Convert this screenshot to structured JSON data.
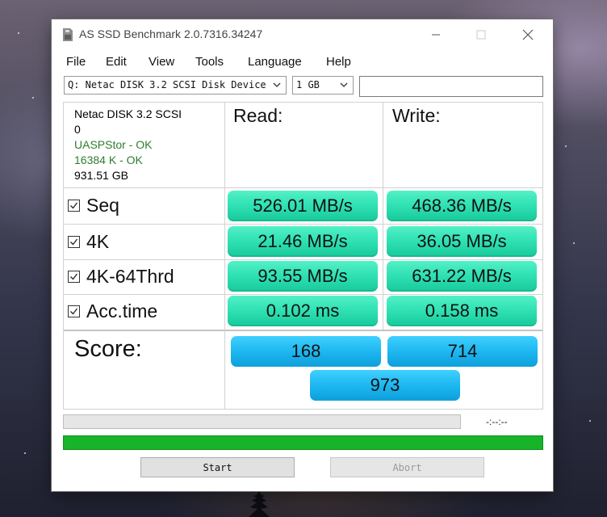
{
  "window": {
    "title": "AS SSD Benchmark 2.0.7316.34247"
  },
  "menu": [
    "File",
    "Edit",
    "View",
    "Tools",
    "Language",
    "Help"
  ],
  "drive_select": {
    "value": "Q: Netac DISK 3.2 SCSI Disk Device"
  },
  "size_select": {
    "value": "1 GB"
  },
  "drive_info": {
    "name": "Netac DISK 3.2 SCSI",
    "line2": "0",
    "driver": "UASPStor - OK",
    "alignment": "16384 K - OK",
    "capacity": "931.51 GB"
  },
  "headers": {
    "read": "Read:",
    "write": "Write:"
  },
  "tests": [
    {
      "label": "Seq",
      "checked": true,
      "read": "526.01 MB/s",
      "write": "468.36 MB/s"
    },
    {
      "label": "4K",
      "checked": true,
      "read": "21.46 MB/s",
      "write": "36.05 MB/s"
    },
    {
      "label": "4K-64Thrd",
      "checked": true,
      "read": "93.55 MB/s",
      "write": "631.22 MB/s"
    },
    {
      "label": "Acc.time",
      "checked": true,
      "read": "0.102 ms",
      "write": "0.158 ms"
    }
  ],
  "score": {
    "label": "Score:",
    "read": "168",
    "write": "714",
    "total": "973"
  },
  "progress": {
    "time": "-:--:--",
    "fraction": 0
  },
  "total_progress": {
    "fraction": 1
  },
  "buttons": {
    "start": "Start",
    "abort": "Abort"
  },
  "colors": {
    "result": "#2ee0b3",
    "score": "#1bb5ef",
    "progress": "#17b42a"
  }
}
